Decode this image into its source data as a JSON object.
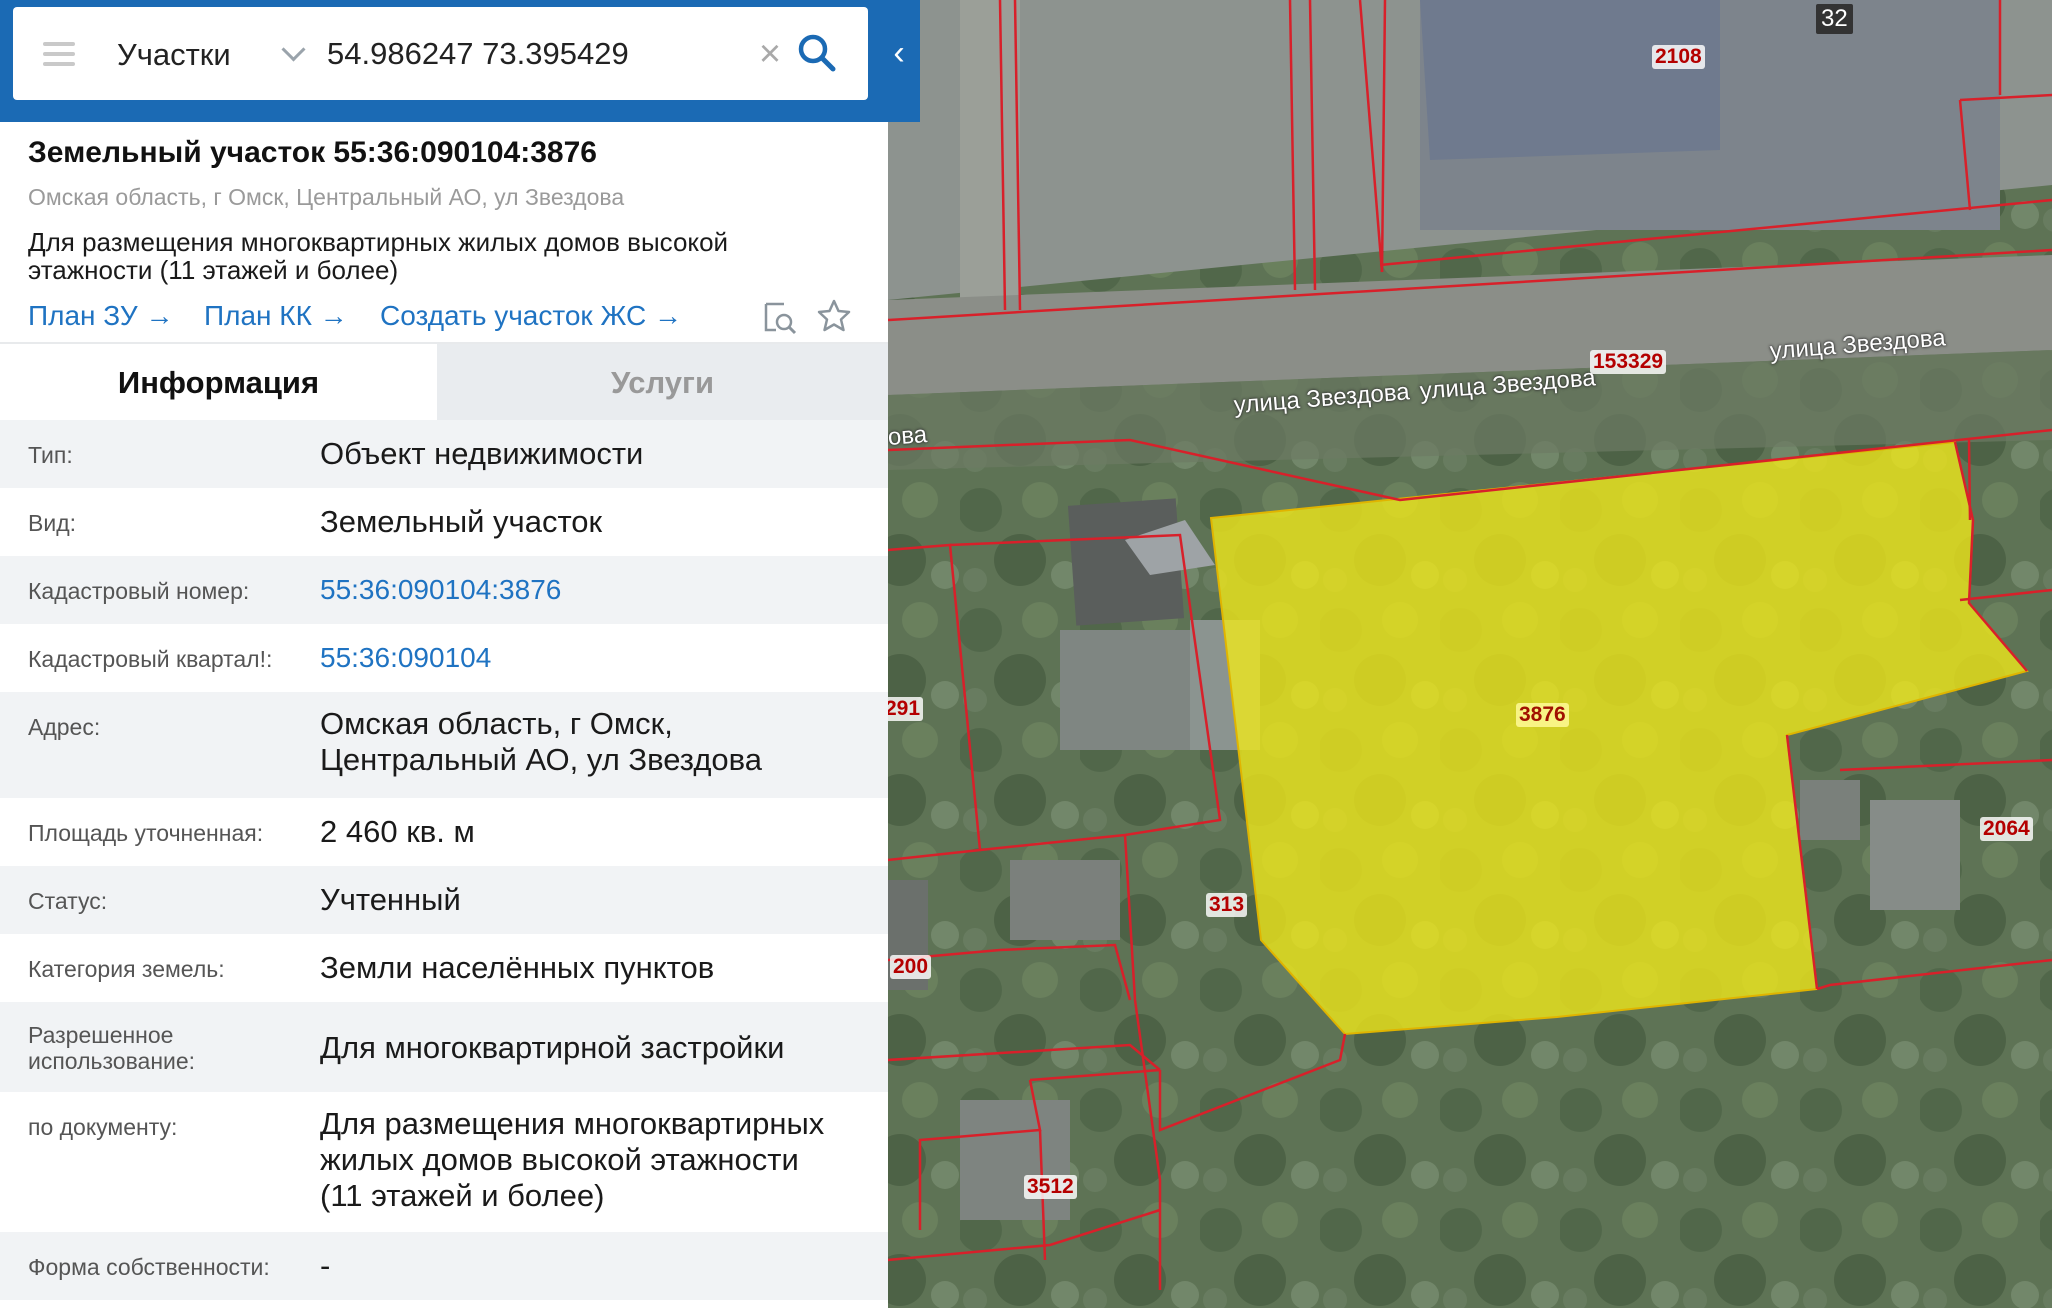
{
  "search": {
    "layer": "Участки",
    "query": "54.986247 73.395429"
  },
  "plot": {
    "title": "Земельный участок 55:36:090104:3876",
    "address_line": "Омская область, г Омск, Центральный АО, ул Звездова",
    "purpose": "Для размещения многоквартирных жилых домов высокой этажности (11 этажей и более)",
    "links": [
      "План ЗУ →",
      "План КК →",
      "Создать участок ЖС →"
    ]
  },
  "tabs": [
    "Информация",
    "Услуги"
  ],
  "info": {
    "type_label": "Тип:",
    "type": "Объект недвижимости",
    "kind_label": "Вид:",
    "kind": "Земельный участок",
    "cad_label": "Кадастровый номер:",
    "cad": "55:36:090104:3876",
    "quarter_label": "Кадастровый квартал!:",
    "quarter": "55:36:090104",
    "addr_label": "Адрес:",
    "addr1": "Омская область, г Омск,",
    "addr2": "Центральный АО, ул Звездова",
    "area_label": "Площадь уточненная:",
    "area": "2 460 кв. м",
    "status_label": "Статус:",
    "status": "Учтенный",
    "category_label": "Категория земель:",
    "category": "Земли населённых пунктов",
    "use_label1": "Разрешенное",
    "use_label2": "использование:",
    "use": "Для многоквартирной застройки",
    "doc_label": "по документу:",
    "doc1": "Для размещения многоквартирных",
    "doc2": "жилых домов высокой этажности",
    "doc3": "(11 этажей и более)",
    "own_label": "Форма собственности:",
    "own": "-"
  },
  "map": {
    "tile_number": "32",
    "street_label": "улица Звездова",
    "street_label_partial": "ова",
    "plot_labels": [
      "2108",
      "153329",
      "3876",
      "291",
      "313",
      "2064",
      "200",
      "3512"
    ],
    "colors": {
      "boundary": "#d8202a",
      "selected_fill": "#f2ea1a",
      "accent": "#1b6ab4",
      "link": "#1f73c2"
    }
  }
}
